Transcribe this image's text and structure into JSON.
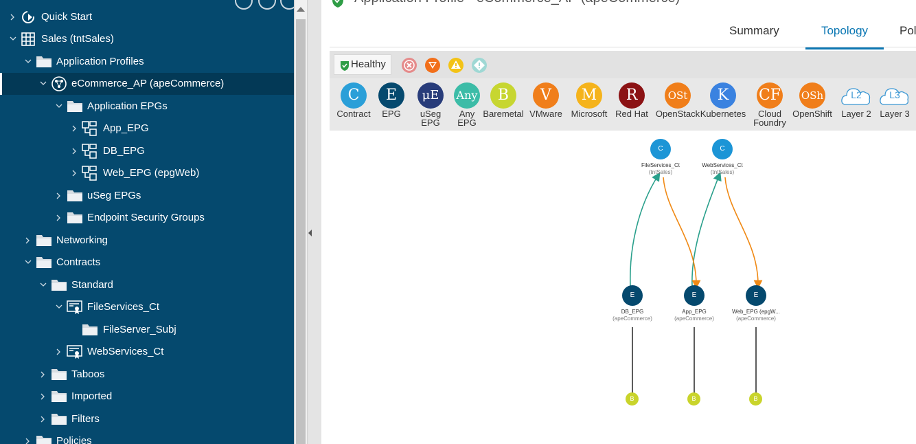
{
  "nav": {
    "items": [
      {
        "label": "Quick Start"
      },
      {
        "label": "Sales (tntSales)"
      },
      {
        "label": "Application Profiles"
      },
      {
        "label": "eCommerce_AP (apeCommerce)"
      },
      {
        "label": "Application EPGs"
      },
      {
        "label": "App_EPG"
      },
      {
        "label": "DB_EPG"
      },
      {
        "label": "Web_EPG (epgWeb)"
      },
      {
        "label": "uSeg EPGs"
      },
      {
        "label": "Endpoint Security Groups"
      },
      {
        "label": "Networking"
      },
      {
        "label": "Contracts"
      },
      {
        "label": "Standard"
      },
      {
        "label": "FileServices_Ct"
      },
      {
        "label": "FileServer_Subj"
      },
      {
        "label": "WebServices_Ct"
      },
      {
        "label": "Taboos"
      },
      {
        "label": "Imported"
      },
      {
        "label": "Filters"
      },
      {
        "label": "Policies"
      }
    ]
  },
  "header": {
    "title": "Application Profile - eCommerce_AP (apeCommerce)"
  },
  "tabs": [
    {
      "label": "Summary"
    },
    {
      "label": "Topology"
    },
    {
      "label": "Pol"
    }
  ],
  "health": {
    "label": "Healthy",
    "colors": {
      "healthy": "#2f9d46",
      "critical": "#e58b8b",
      "major": "#f26f1a",
      "minor": "#f3c316",
      "warning": "#9fd8d4"
    }
  },
  "legend": [
    {
      "symbol": "C",
      "label": "Contract",
      "color": "#2a9fd8"
    },
    {
      "symbol": "E",
      "label": "EPG",
      "color": "#05496e"
    },
    {
      "symbol": "μE",
      "label": "uSeg\nEPG",
      "color": "#283c7a"
    },
    {
      "symbol": "Any",
      "label": "Any\nEPG",
      "color": "#3cbca7"
    },
    {
      "symbol": "B",
      "label": "Baremetal",
      "color": "#c7d631"
    },
    {
      "symbol": "V",
      "label": "VMware",
      "color": "#f07e1a"
    },
    {
      "symbol": "M",
      "label": "Microsoft",
      "color": "#f5b31b"
    },
    {
      "symbol": "R",
      "label": "Red Hat",
      "color": "#8b1214"
    },
    {
      "symbol": "OSt",
      "label": "OpenStack",
      "color": "#f07e1a"
    },
    {
      "symbol": "K",
      "label": "Kubernetes",
      "color": "#3a82e0"
    },
    {
      "symbol": "CF",
      "label": "Cloud\nFoundry",
      "color": "#f07e1a"
    },
    {
      "symbol": "OSh",
      "label": "OpenShift",
      "color": "#f07e1a"
    },
    {
      "symbol": "L2",
      "label": "Layer 2",
      "color": "#3a97d4"
    },
    {
      "symbol": "L3",
      "label": "Layer 3",
      "color": "#3a97d4"
    }
  ],
  "topology": {
    "contracts": [
      {
        "symbol": "C",
        "name": "FileServices_Ct",
        "tenant": "(tntSales)"
      },
      {
        "symbol": "C",
        "name": "WebServices_Ct",
        "tenant": "(tntSales)"
      }
    ],
    "epgs": [
      {
        "symbol": "E",
        "name": "DB_EPG",
        "ap": "(apeCommerce)"
      },
      {
        "symbol": "E",
        "name": "App_EPG",
        "ap": "(apeCommerce)"
      },
      {
        "symbol": "E",
        "name": "Web_EPG (epgW...",
        "ap": "(apeCommerce)"
      }
    ],
    "baremetal": [
      {
        "symbol": "B"
      },
      {
        "symbol": "B"
      },
      {
        "symbol": "B"
      }
    ],
    "colors": {
      "provider": "#2aa08c",
      "consumer": "#f08a16",
      "contract": "#1c95d6",
      "epg": "#05496e",
      "baremetal": "#c9d42b"
    }
  }
}
